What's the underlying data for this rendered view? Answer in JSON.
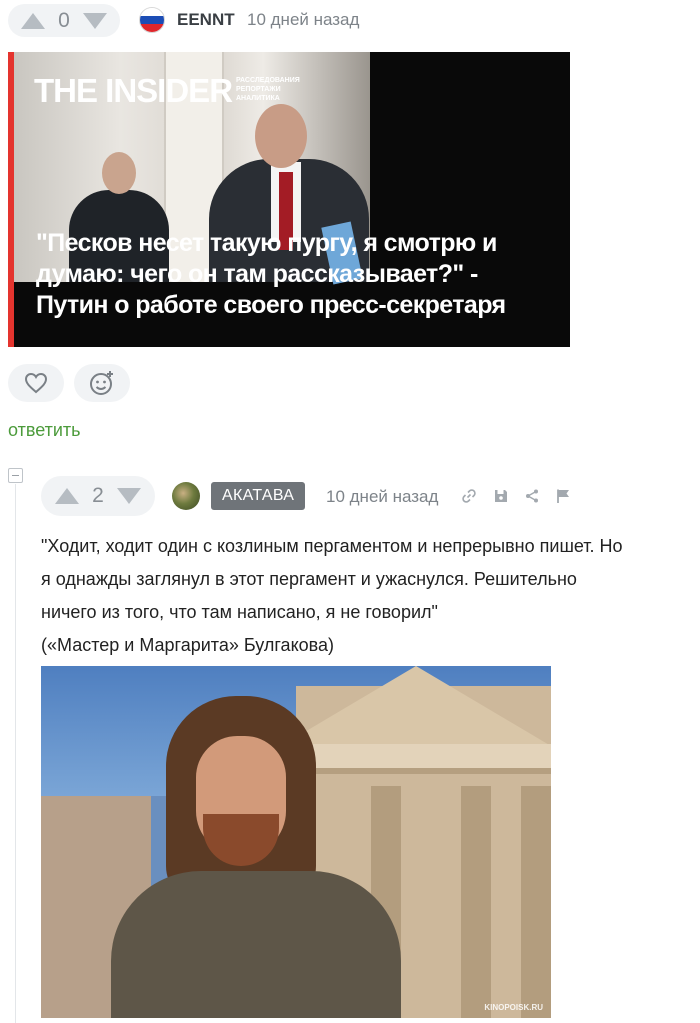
{
  "post": {
    "vote_count": "0",
    "author": "EENNT",
    "time": "10 дней назад",
    "image": {
      "logo": "THE INSIDER",
      "logo_sub_1": "РАССЛЕДОВАНИЯ",
      "logo_sub_2": "РЕПОРТАЖИ",
      "logo_sub_3": "АНАЛИТИКА",
      "quote_line_1": "\"Песков несет такую пургу, я смотрю и",
      "quote_line_2": "думаю: чего он там рассказывает?\" -",
      "quote_line_3": "Путин о работе своего пресс-секретаря"
    },
    "reply_label": "ответить"
  },
  "reply": {
    "vote_count": "2",
    "author": "АКАТАВА",
    "time": "10 дней назад",
    "text_line_1": "\"Ходит, ходит один с козлиным пергаментом и непрерывно пишет. Но",
    "text_line_2": "я однажды заглянул в этот пергамент и ужаснулся. Решительно",
    "text_line_3": "ничего из того, что там написано, я не говорил\"",
    "text_line_4": "(«Мастер и Маргарита» Булгакова)",
    "image_watermark": "KINOPOISK.RU"
  },
  "icons": [
    "arrow-up-icon",
    "arrow-down-icon",
    "russia-flag-icon",
    "heart-icon",
    "emoji-add-icon",
    "link-icon",
    "save-icon",
    "share-icon",
    "flag-icon"
  ],
  "colors": {
    "accent_green": "#4c9b3b",
    "badge_gray": "#6f7479",
    "chip_bg": "#f1f3f5"
  }
}
